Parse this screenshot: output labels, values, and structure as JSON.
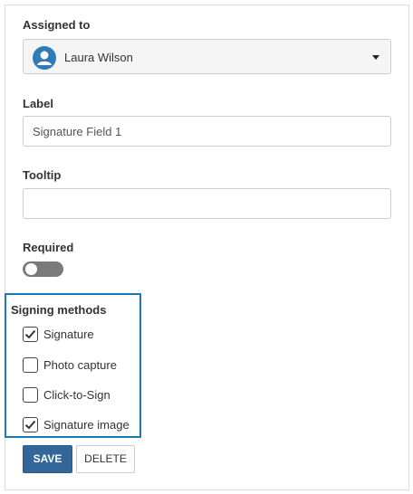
{
  "assigned_to": {
    "label": "Assigned to",
    "selected": "Laura Wilson",
    "avatar_icon": "user-icon"
  },
  "label_field": {
    "label": "Label",
    "value": "Signature Field 1"
  },
  "tooltip_field": {
    "label": "Tooltip",
    "value": ""
  },
  "required": {
    "label": "Required",
    "on": false
  },
  "signing_methods": {
    "title": "Signing methods",
    "items": [
      {
        "label": "Signature",
        "checked": true
      },
      {
        "label": "Photo capture",
        "checked": false
      },
      {
        "label": "Click-to-Sign",
        "checked": false
      },
      {
        "label": "Signature image",
        "checked": true
      }
    ]
  },
  "actions": {
    "save_label": "SAVE",
    "delete_label": "DELETE"
  },
  "colors": {
    "accent": "#1a7ab5",
    "save_button": "#336799",
    "avatar": "#2e7bb8",
    "toggle_off": "#7a7a7a"
  }
}
